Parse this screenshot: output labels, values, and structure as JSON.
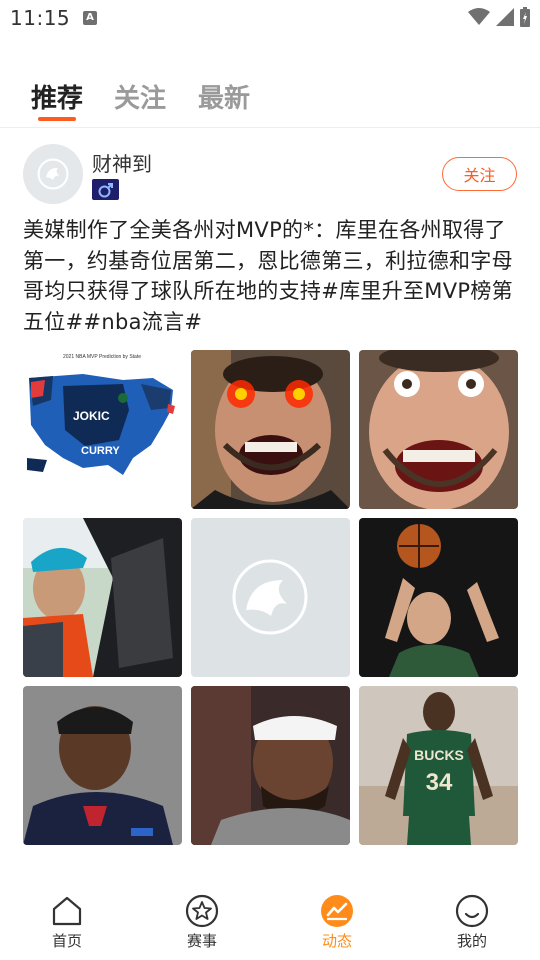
{
  "status_bar": {
    "time": "11:15",
    "notification_icon": "A"
  },
  "tabs": [
    {
      "label": "推荐",
      "active": true
    },
    {
      "label": "关注",
      "active": false
    },
    {
      "label": "最新",
      "active": false
    }
  ],
  "post": {
    "username": "财神到",
    "follow_label": "关注",
    "text": "美媒制作了全美各州对MVP的*：库里在各州取得了第一，约基奇位居第二，恩比德第三，利拉德和字母哥均只获得了球队所在地的支持#库里升至MVP榜第五位##nba流言#",
    "images": [
      {
        "name": "mvp-map-image",
        "labels": [
          "2021 NBA MVP Prediction by State",
          "JOKIC",
          "CURRY"
        ]
      },
      {
        "name": "curry-laser-eyes-image",
        "labels": []
      },
      {
        "name": "curry-funny-face-image",
        "labels": []
      },
      {
        "name": "curry-car-selfie-image",
        "labels": []
      },
      {
        "name": "image-placeholder",
        "labels": []
      },
      {
        "name": "jokic-shooting-image",
        "labels": []
      },
      {
        "name": "embiid-image",
        "labels": []
      },
      {
        "name": "lillard-image",
        "labels": []
      },
      {
        "name": "giannis-image",
        "labels": [
          "BUCKS",
          "34"
        ]
      }
    ]
  },
  "bottom_nav": [
    {
      "label": "首页",
      "icon": "home-icon",
      "active": false
    },
    {
      "label": "赛事",
      "icon": "star-icon",
      "active": false
    },
    {
      "label": "动态",
      "icon": "activity-icon",
      "active": true
    },
    {
      "label": "我的",
      "icon": "smile-icon",
      "active": false
    }
  ],
  "colors": {
    "accent": "#ff5a1f",
    "nav_active": "#ff8c1a",
    "tab_inactive": "#9a9a9a"
  }
}
